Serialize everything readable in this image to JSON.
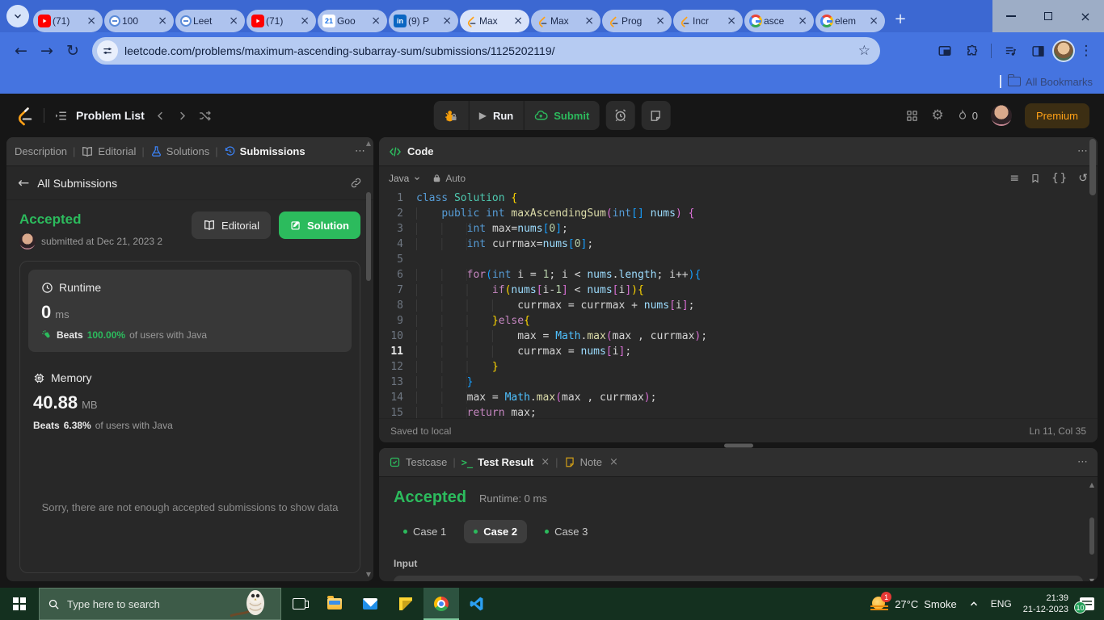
{
  "browser": {
    "tabs": [
      {
        "label": "(71)",
        "icon": "youtube",
        "active": false
      },
      {
        "label": "100",
        "icon": "circle",
        "active": false
      },
      {
        "label": "Leet",
        "icon": "circle",
        "active": false
      },
      {
        "label": "(71)",
        "icon": "youtube",
        "active": false
      },
      {
        "label": "Goo",
        "icon": "calendar",
        "active": false
      },
      {
        "label": "(9) P",
        "icon": "linkedin",
        "active": false
      },
      {
        "label": "Max",
        "icon": "leetcode",
        "active": true
      },
      {
        "label": "Max",
        "icon": "leetcode",
        "active": false
      },
      {
        "label": "Prog",
        "icon": "leetcode",
        "active": false
      },
      {
        "label": "Incr",
        "icon": "leetcode",
        "active": false
      },
      {
        "label": "asce",
        "icon": "google",
        "active": false
      },
      {
        "label": "elem",
        "icon": "google",
        "active": false
      }
    ],
    "url": "leetcode.com/problems/maximum-ascending-subarray-sum/submissions/1125202119/",
    "all_bookmarks_label": "All Bookmarks"
  },
  "lc_header": {
    "problem_list_label": "Problem List",
    "run_label": "Run",
    "submit_label": "Submit",
    "streak_count": "0",
    "premium_label": "Premium"
  },
  "left_panel": {
    "tabs": [
      {
        "label": "Description",
        "icon": null,
        "active": false
      },
      {
        "label": "Editorial",
        "icon": "book",
        "active": false
      },
      {
        "label": "Solutions",
        "icon": "flask",
        "active": false
      },
      {
        "label": "Submissions",
        "icon": "history",
        "active": true
      }
    ],
    "back_label": "All Submissions",
    "status": "Accepted",
    "submitted_text": "submitted at Dec 21, 2023 2",
    "editorial_button": "Editorial",
    "solution_button": "Solution",
    "runtime": {
      "title": "Runtime",
      "value": "0",
      "unit": "ms",
      "beats_prefix": "Beats",
      "beats_value": "100.00%",
      "beats_suffix": "of users with Java"
    },
    "memory": {
      "title": "Memory",
      "value": "40.88",
      "unit": "MB",
      "beats_prefix": "Beats",
      "beats_value": "6.38%",
      "beats_suffix": "of users with Java"
    },
    "empty_note": "Sorry, there are not enough accepted submissions to show data"
  },
  "code_panel": {
    "title": "Code",
    "language": "Java",
    "auto_label": "Auto",
    "saved_status": "Saved to local",
    "cursor_position": "Ln 11, Col 35",
    "current_line": 11,
    "lines": [
      [
        {
          "t": "class ",
          "c": "kw"
        },
        {
          "t": "Solution ",
          "c": "type"
        },
        {
          "t": "{",
          "c": "b1"
        }
      ],
      [
        {
          "t": "    ",
          "c": "pl"
        },
        {
          "t": "public ",
          "c": "kw"
        },
        {
          "t": "int ",
          "c": "kw"
        },
        {
          "t": "maxAscendingSum",
          "c": "fn"
        },
        {
          "t": "(",
          "c": "b2"
        },
        {
          "t": "int",
          "c": "kw"
        },
        {
          "t": "[]",
          "c": "b3"
        },
        {
          "t": " ",
          "c": "def"
        },
        {
          "t": "nums",
          "c": "var"
        },
        {
          "t": ")",
          "c": "b2"
        },
        {
          "t": " ",
          "c": "def"
        },
        {
          "t": "{",
          "c": "b2"
        }
      ],
      [
        {
          "t": "        ",
          "c": "pl"
        },
        {
          "t": "int ",
          "c": "kw"
        },
        {
          "t": "max=",
          "c": "def"
        },
        {
          "t": "nums",
          "c": "var"
        },
        {
          "t": "[",
          "c": "b3"
        },
        {
          "t": "0",
          "c": "num"
        },
        {
          "t": "]",
          "c": "b3"
        },
        {
          "t": ";",
          "c": "def"
        }
      ],
      [
        {
          "t": "        ",
          "c": "pl"
        },
        {
          "t": "int ",
          "c": "kw"
        },
        {
          "t": "currmax=",
          "c": "def"
        },
        {
          "t": "nums",
          "c": "var"
        },
        {
          "t": "[",
          "c": "b3"
        },
        {
          "t": "0",
          "c": "num"
        },
        {
          "t": "]",
          "c": "b3"
        },
        {
          "t": ";",
          "c": "def"
        }
      ],
      [],
      [
        {
          "t": "        ",
          "c": "pl"
        },
        {
          "t": "for",
          "c": "ctrl"
        },
        {
          "t": "(",
          "c": "b3"
        },
        {
          "t": "int ",
          "c": "kw"
        },
        {
          "t": "i = ",
          "c": "def"
        },
        {
          "t": "1",
          "c": "num"
        },
        {
          "t": "; i < ",
          "c": "def"
        },
        {
          "t": "nums",
          "c": "var"
        },
        {
          "t": ".",
          "c": "def"
        },
        {
          "t": "length",
          "c": "var"
        },
        {
          "t": "; i++",
          "c": "def"
        },
        {
          "t": ")",
          "c": "b3"
        },
        {
          "t": "{",
          "c": "b3"
        }
      ],
      [
        {
          "t": "            ",
          "c": "pl"
        },
        {
          "t": "if",
          "c": "ctrl"
        },
        {
          "t": "(",
          "c": "b1"
        },
        {
          "t": "nums",
          "c": "var"
        },
        {
          "t": "[",
          "c": "b2"
        },
        {
          "t": "i-",
          "c": "def"
        },
        {
          "t": "1",
          "c": "num"
        },
        {
          "t": "]",
          "c": "b2"
        },
        {
          "t": " < ",
          "c": "def"
        },
        {
          "t": "nums",
          "c": "var"
        },
        {
          "t": "[",
          "c": "b2"
        },
        {
          "t": "i",
          "c": "def"
        },
        {
          "t": "]",
          "c": "b2"
        },
        {
          "t": ")",
          "c": "b1"
        },
        {
          "t": "{",
          "c": "b1"
        }
      ],
      [
        {
          "t": "                ",
          "c": "pl"
        },
        {
          "t": "currmax = currmax + ",
          "c": "def"
        },
        {
          "t": "nums",
          "c": "var"
        },
        {
          "t": "[",
          "c": "b2"
        },
        {
          "t": "i",
          "c": "def"
        },
        {
          "t": "]",
          "c": "b2"
        },
        {
          "t": ";",
          "c": "def"
        }
      ],
      [
        {
          "t": "            ",
          "c": "pl"
        },
        {
          "t": "}",
          "c": "b1"
        },
        {
          "t": "else",
          "c": "ctrl"
        },
        {
          "t": "{",
          "c": "b1"
        }
      ],
      [
        {
          "t": "                ",
          "c": "pl"
        },
        {
          "t": "max = ",
          "c": "def"
        },
        {
          "t": "Math",
          "c": "cls"
        },
        {
          "t": ".",
          "c": "def"
        },
        {
          "t": "max",
          "c": "fn"
        },
        {
          "t": "(",
          "c": "b2"
        },
        {
          "t": "max , currmax",
          "c": "def"
        },
        {
          "t": ")",
          "c": "b2"
        },
        {
          "t": ";",
          "c": "def"
        }
      ],
      [
        {
          "t": "                ",
          "c": "pl"
        },
        {
          "t": "currmax = ",
          "c": "def"
        },
        {
          "t": "nums",
          "c": "var"
        },
        {
          "t": "[",
          "c": "b2"
        },
        {
          "t": "i",
          "c": "def"
        },
        {
          "t": "]",
          "c": "b2"
        },
        {
          "t": ";",
          "c": "def"
        }
      ],
      [
        {
          "t": "            ",
          "c": "pl"
        },
        {
          "t": "}",
          "c": "b1"
        }
      ],
      [
        {
          "t": "        ",
          "c": "pl"
        },
        {
          "t": "}",
          "c": "b3"
        }
      ],
      [
        {
          "t": "        ",
          "c": "pl"
        },
        {
          "t": "max = ",
          "c": "def"
        },
        {
          "t": "Math",
          "c": "cls"
        },
        {
          "t": ".",
          "c": "def"
        },
        {
          "t": "max",
          "c": "fn"
        },
        {
          "t": "(",
          "c": "b2"
        },
        {
          "t": "max , currmax",
          "c": "def"
        },
        {
          "t": ")",
          "c": "b2"
        },
        {
          "t": ";",
          "c": "def"
        }
      ],
      [
        {
          "t": "        ",
          "c": "pl"
        },
        {
          "t": "return ",
          "c": "ctrl"
        },
        {
          "t": "max;",
          "c": "def"
        }
      ]
    ]
  },
  "result_panel": {
    "tabs": [
      {
        "label": "Testcase",
        "icon": "checksq",
        "closable": false,
        "active": false
      },
      {
        "label": "Test Result",
        "icon": "terminal",
        "closable": true,
        "active": true
      },
      {
        "label": "Note",
        "icon": "notetab",
        "closable": true,
        "active": false
      }
    ],
    "status": "Accepted",
    "runtime_text": "Runtime: 0 ms",
    "cases": [
      {
        "label": "Case 1",
        "active": false
      },
      {
        "label": "Case 2",
        "active": true
      },
      {
        "label": "Case 3",
        "active": false
      }
    ],
    "input_label": "Input"
  },
  "taskbar": {
    "search_placeholder": "Type here to search",
    "weather_temp": "27°C",
    "weather_desc": "Smoke",
    "weather_badge": "1",
    "language": "ENG",
    "time": "21:39",
    "date": "21-12-2023",
    "notification_badge": "10"
  },
  "colors": {
    "accent_green": "#2cbb5d",
    "leetcode_orange": "#ffa116",
    "chrome_blue": "#4574e0",
    "taskbar_green": "#14301f"
  }
}
